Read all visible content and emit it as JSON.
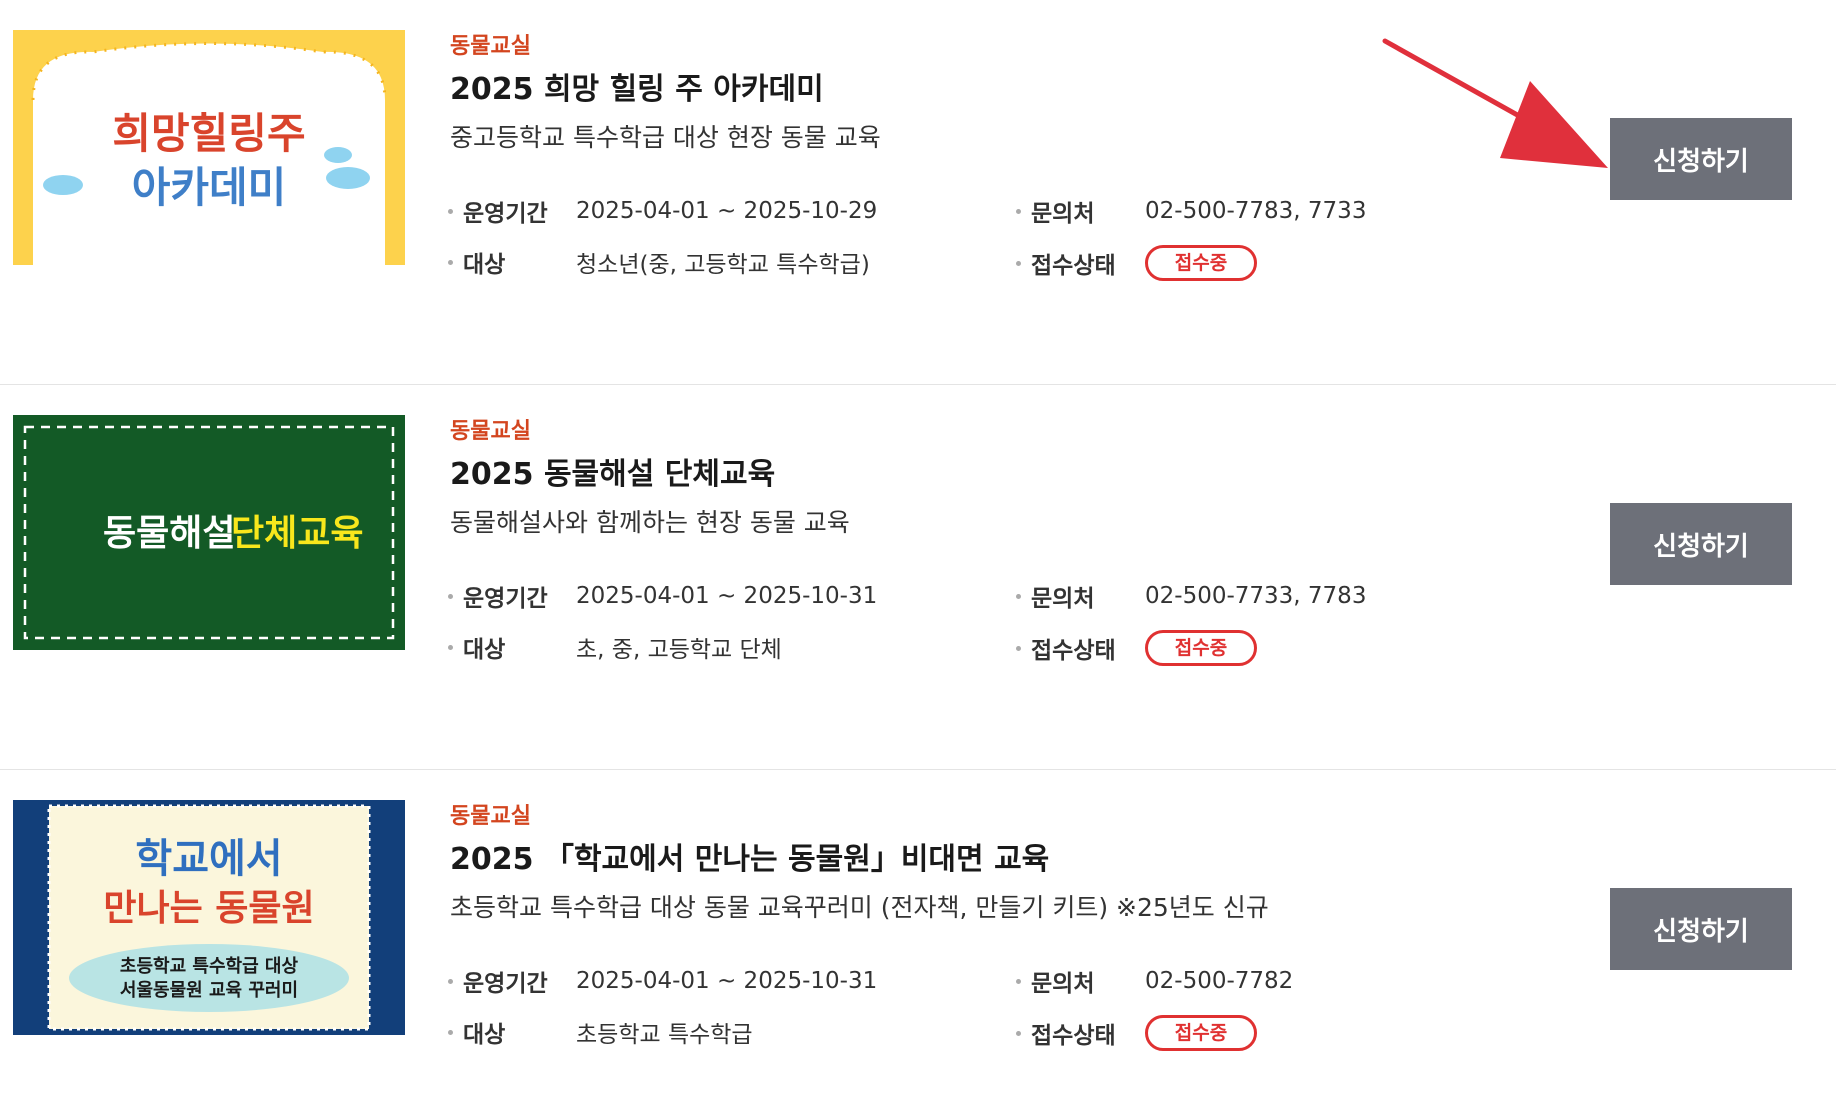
{
  "programs": [
    {
      "category": "동물교실",
      "title": "2025 희망 힐링 주 아카데미",
      "description": "중고등학교 특수학급 대상 현장 동물 교육",
      "period_label": "운영기간",
      "period": "2025-04-01 ~ 2025-10-29",
      "target_label": "대상",
      "target": "청소년(중, 고등학교 특수학급)",
      "contact_label": "문의처",
      "contact": "02-500-7783, 7733",
      "status_label": "접수상태",
      "status": "접수중",
      "apply_label": "신청하기",
      "thumb_text": [
        "희망힐링주",
        "아카데미"
      ]
    },
    {
      "category": "동물교실",
      "title": "2025 동물해설 단체교육",
      "description": "동물해설사와 함께하는 현장 동물 교육",
      "period_label": "운영기간",
      "period": "2025-04-01 ~ 2025-10-31",
      "target_label": "대상",
      "target": "초, 중, 고등학교 단체",
      "contact_label": "문의처",
      "contact": "02-500-7733, 7783",
      "status_label": "접수상태",
      "status": "접수중",
      "apply_label": "신청하기",
      "thumb_text": [
        "동물해설",
        "단체교육"
      ]
    },
    {
      "category": "동물교실",
      "title": "2025 「학교에서 만나는 동물원」비대면 교육",
      "description": "초등학교 특수학급 대상 동물 교육꾸러미 (전자책, 만들기 키트) ※25년도 신규",
      "period_label": "운영기간",
      "period": "2025-04-01 ~ 2025-10-31",
      "target_label": "대상",
      "target": "초등학교 특수학급",
      "contact_label": "문의처",
      "contact": "02-500-7782",
      "status_label": "접수상태",
      "status": "접수중",
      "apply_label": "신청하기",
      "thumb_text": [
        "학교에서",
        "만나는 동물원",
        "초등학교 특수학급 대상",
        "서울동물원 교육 꾸러미"
      ]
    }
  ],
  "colors": {
    "category": "#d3451f",
    "badge": "#e03131",
    "button": "#6d7079",
    "arrow": "#e0303c"
  }
}
